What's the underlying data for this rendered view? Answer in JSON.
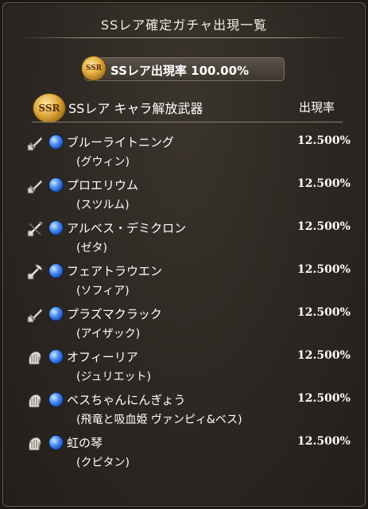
{
  "title": "SSレア確定ガチャ出現一覧",
  "rate_box": {
    "badge": "SSR",
    "label": "SSレア出現率 100.00%"
  },
  "section": {
    "badge": "SSR",
    "title": "SSレア キャラ解放武器",
    "rate_header": "出現率"
  },
  "items": [
    {
      "name": "ブルーライトニング",
      "character": "(グウィン)",
      "rate": "12.500%",
      "weapon_icon": "sword-icon"
    },
    {
      "name": "プロエリウム",
      "character": "(スツルム)",
      "rate": "12.500%",
      "weapon_icon": "sword-icon"
    },
    {
      "name": "アルベス・デミクロン",
      "character": "(ゼタ)",
      "rate": "12.500%",
      "weapon_icon": "spear-icon"
    },
    {
      "name": "フェアトラウエン",
      "character": "(ソフィア)",
      "rate": "12.500%",
      "weapon_icon": "axe-icon"
    },
    {
      "name": "プラズマクラック",
      "character": "(アイザック)",
      "rate": "12.500%",
      "weapon_icon": "sword-icon"
    },
    {
      "name": "オフィーリア",
      "character": "(ジュリエット)",
      "rate": "12.500%",
      "weapon_icon": "harp-icon"
    },
    {
      "name": "ベスちゃんにんぎょう",
      "character": "(飛竜と吸血姫 ヴァンピィ&ベス)",
      "rate": "12.500%",
      "weapon_icon": "harp-icon"
    },
    {
      "name": "虹の琴",
      "character": "(クピタン)",
      "rate": "12.500%",
      "weapon_icon": "harp-icon"
    }
  ]
}
